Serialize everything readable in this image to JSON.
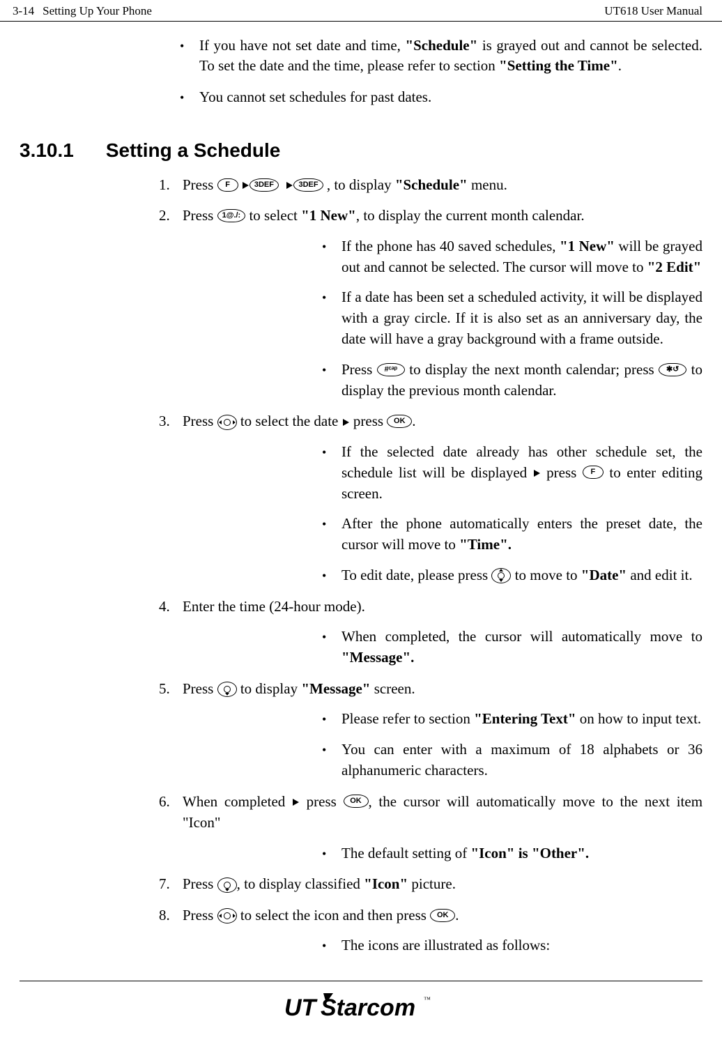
{
  "header": {
    "page_num": "3-14",
    "section": "Setting Up Your Phone",
    "manual_title": "UT618 User Manual"
  },
  "intro": {
    "b1_pre": "If you have not set date and time, ",
    "b1_bold1": "\"Schedule\"",
    "b1_mid": " is grayed out and cannot be selected. To set the date and the time, please refer to section ",
    "b1_bold2": "\"Setting the Time\"",
    "b1_post": ".",
    "b2": "You cannot set schedules for past dates."
  },
  "section": {
    "num": "3.10.1",
    "title": "Setting a Schedule"
  },
  "steps": {
    "s1": {
      "num": "1.",
      "t1": "Press ",
      "t2": ", to display ",
      "bold": "\"Schedule\"",
      "t3": " menu."
    },
    "s2": {
      "num": "2.",
      "t1": "Press ",
      "t2": " to select ",
      "bold": "\"1 New\"",
      "t3": ", to display the current month calendar.",
      "sub1_t1": "If the phone has 40 saved schedules, ",
      "sub1_bold1": "\"1 New\"",
      "sub1_t2": " will be grayed out and cannot be selected. The cursor will move to ",
      "sub1_bold2": "\"2 Edit\"",
      "sub2": "If a date has been set a scheduled activity, it will be displayed with a gray circle. If it is also set as an anniversary day, the date will have a gray background with a frame outside.",
      "sub3_t1": "Press ",
      "sub3_t2": " to display the next month calendar; press ",
      "sub3_t3": " to display the previous month calendar."
    },
    "s3": {
      "num": "3.",
      "t1": "Press ",
      "t2": " to select the date ",
      "t3": " press ",
      "t4": ".",
      "sub1_t1": "If the selected date already has other schedule set, the schedule list will be displayed ",
      "sub1_t2": " press ",
      "sub1_t3": " to enter editing screen.",
      "sub2_t1": "After the phone automatically enters the preset date, the cursor will move to ",
      "sub2_bold": "\"Time\".",
      "sub3_t1": "To edit date, please press ",
      "sub3_t2": " to move to ",
      "sub3_bold": "\"Date\"",
      "sub3_t3": " and edit it."
    },
    "s4": {
      "num": "4.",
      "t1": "Enter the time (24-hour mode).",
      "sub1_t1": "When completed, the cursor will automatically move to ",
      "sub1_bold": "\"Message\"."
    },
    "s5": {
      "num": "5.",
      "t1": "Press ",
      "t2": " to display ",
      "bold": "\"Message\"",
      "t3": " screen.",
      "sub1_t1": "Please refer to section ",
      "sub1_bold": "\"Entering Text\"",
      "sub1_t2": " on how to input text.",
      "sub2": "You can enter with a maximum of 18 alphabets or 36 alphanumeric characters."
    },
    "s6": {
      "num": "6.",
      "t1": "When completed ",
      "t2": " press ",
      "t3": ", the cursor will automatically move to the next item \"Icon\"",
      "sub1_t1": "The default setting of ",
      "sub1_bold": "\"Icon\" is \"Other\"."
    },
    "s7": {
      "num": "7.",
      "t1": "Press ",
      "t2": ", to display classified ",
      "bold": "\"Icon\"",
      "t3": " picture."
    },
    "s8": {
      "num": "8.",
      "t1": "Press ",
      "t2": " to select the icon and then press ",
      "t3": ".",
      "sub1": "The icons are illustrated as follows:"
    }
  },
  "icons": {
    "F": "F",
    "three": "3DEF",
    "one": "1@./:",
    "hash": "#ᶜᵃᵖ",
    "star": "✱↺",
    "ok": "OK"
  },
  "logo": {
    "text1": "UT",
    "text2": "Starcom"
  }
}
